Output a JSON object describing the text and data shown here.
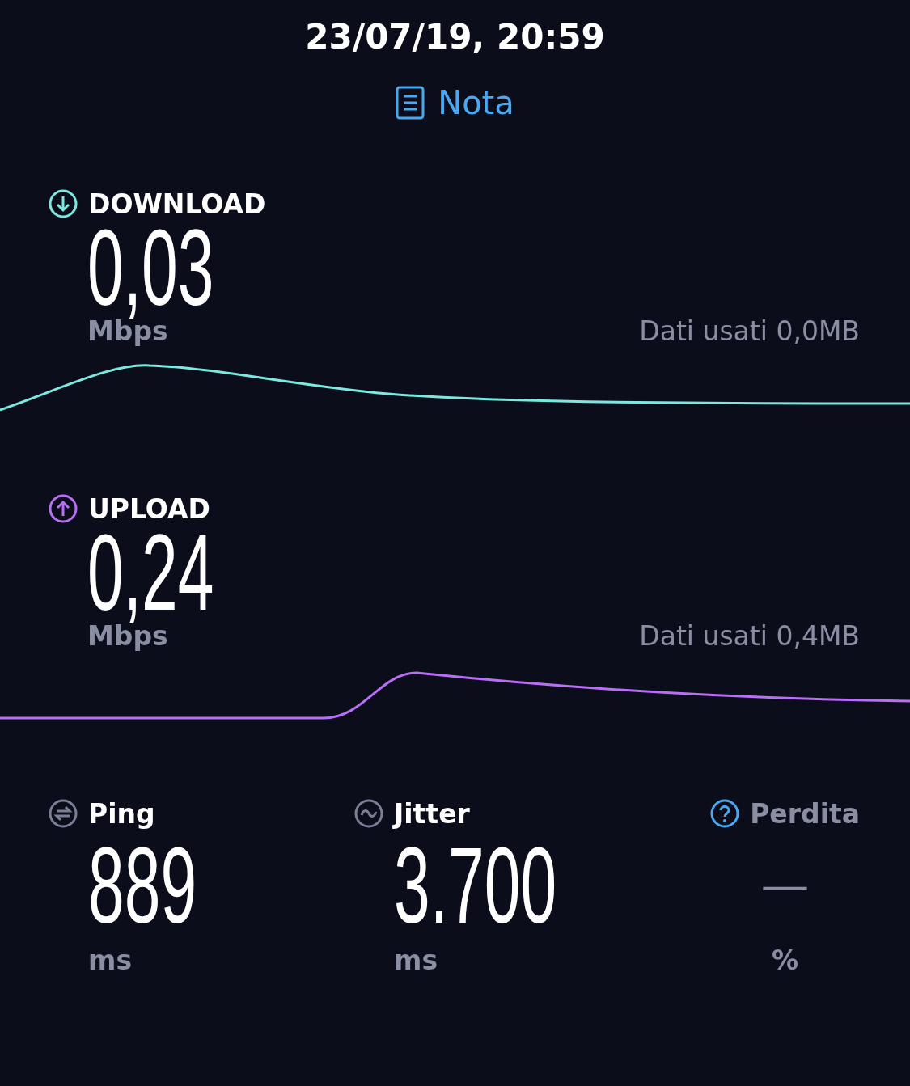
{
  "timestamp": "23/07/19, 20:59",
  "note_link": {
    "label": "Nota"
  },
  "speeds": [
    {
      "kind": "download",
      "label": "DOWNLOAD",
      "value": "0,03",
      "unit": "Mbps",
      "data_used": "Dati usati 0,0MB"
    },
    {
      "kind": "upload",
      "label": "UPLOAD",
      "value": "0,24",
      "unit": "Mbps",
      "data_used": "Dati usati 0,4MB"
    }
  ],
  "metrics": [
    {
      "kind": "ping",
      "label": "Ping",
      "value": "889",
      "unit": "ms",
      "disabled": false
    },
    {
      "kind": "jitter",
      "label": "Jitter",
      "value": "3.700",
      "unit": "ms",
      "disabled": false
    },
    {
      "kind": "loss",
      "label": "Perdita",
      "value": "—",
      "unit": "%",
      "disabled": true
    }
  ]
}
